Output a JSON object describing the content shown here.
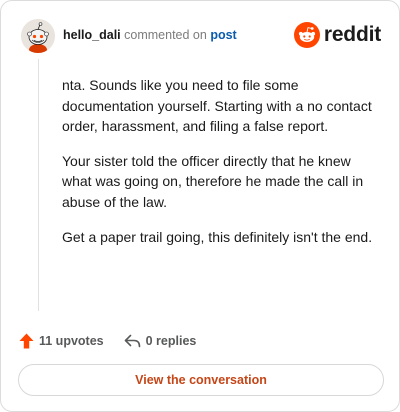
{
  "header": {
    "username": "hello_dali",
    "commented_text": "commented on",
    "post_link": "post",
    "brand": "reddit"
  },
  "comment": {
    "paragraphs": [
      "nta. Sounds like you need to file some documentation yourself. Starting with a no contact order, harassment, and filing a false report.",
      "Your sister told the officer directly that he knew what was going on, therefore he made the call in abuse of the law.",
      "Get a paper trail going, this definitely isn't the end."
    ]
  },
  "actions": {
    "upvotes": "11 upvotes",
    "replies": "0 replies"
  },
  "cta": {
    "label": "View the conversation"
  },
  "colors": {
    "brand_orange": "#ff4500",
    "link_blue": "#0b5cad",
    "cta_text": "#c54618"
  }
}
